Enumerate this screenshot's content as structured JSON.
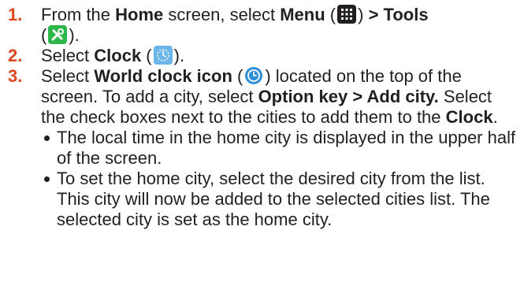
{
  "steps": [
    {
      "num": "1.",
      "parts": {
        "a": "From the ",
        "b_home": "Home",
        "c": " screen, select ",
        "d_menu": "Menu",
        "e": " (",
        "f": ") ",
        "g_tools": "> Tools",
        "h": "(",
        "i": ")."
      },
      "icons": [
        "menu-grid-icon",
        "tools-icon"
      ]
    },
    {
      "num": "2.",
      "parts": {
        "a": "Select ",
        "b_clock": "Clock",
        "c": " (",
        "d": ")."
      },
      "icons": [
        "clock-app-icon"
      ]
    },
    {
      "num": "3.",
      "parts": {
        "a": "Select ",
        "b_world": "World clock icon",
        "c": " (",
        "d": ") located on the top of the screen. To add a city, select ",
        "e_option": "Option key > Add city.",
        "f": " Select the check boxes next to the cities to add them to the ",
        "g_clock": "Clock",
        "h": "."
      },
      "icons": [
        "world-clock-icon"
      ]
    }
  ],
  "bullets": [
    "The local time in the home city is displayed in the upper half of the screen.",
    "To set the home city, select the desired city from the list. This city will now be added to the selected cities list. The selected city is set as the home city."
  ],
  "colors": {
    "step_number": "#e0461d",
    "text": "#231f20",
    "tools_icon_bg": "#2fb84a",
    "clock_icon_bg": "#6bb6e8",
    "world_clock_icon_bg": "#2d8fd6"
  }
}
